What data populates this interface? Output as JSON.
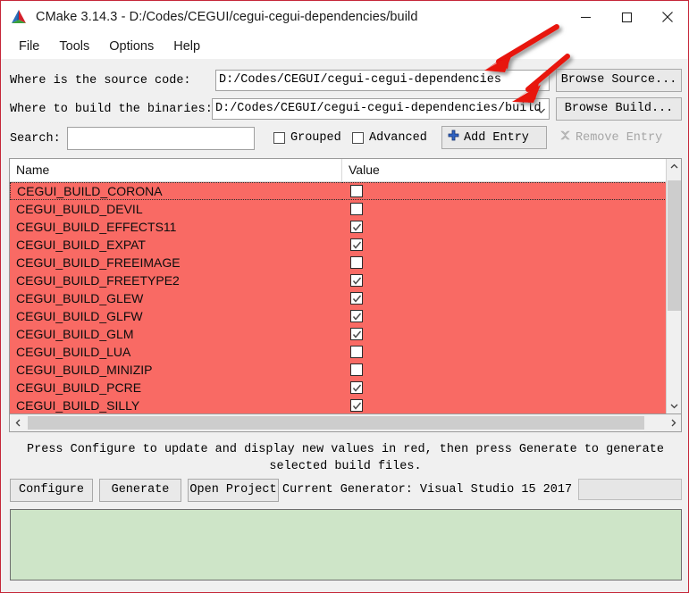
{
  "window": {
    "title": "CMake 3.14.3 - D:/Codes/CEGUI/cegui-cegui-dependencies/build",
    "logo_icon": "cmake-logo-icon",
    "minimize_icon": "minimize-icon",
    "maximize_icon": "maximize-icon",
    "close_icon": "close-icon"
  },
  "menubar": {
    "items": [
      {
        "label": "File"
      },
      {
        "label": "Tools"
      },
      {
        "label": "Options"
      },
      {
        "label": "Help"
      }
    ]
  },
  "paths": {
    "source_label": "Where is the source code:",
    "source_value": "D:/Codes/CEGUI/cegui-cegui-dependencies",
    "browse_source_label": "Browse Source...",
    "binaries_label": "Where to build the binaries:",
    "binaries_value": "D:/Codes/CEGUI/cegui-cegui-dependencies/build",
    "binaries_dropdown_icon": "chevron-down-icon",
    "browse_build_label": "Browse Build..."
  },
  "search": {
    "label": "Search:",
    "value": "",
    "placeholder": "",
    "grouped_label": "Grouped",
    "grouped_checked": false,
    "advanced_label": "Advanced",
    "advanced_checked": false,
    "add_entry_label": "Add Entry",
    "add_entry_icon": "plus-icon",
    "remove_entry_label": "Remove Entry",
    "remove_entry_icon": "remove-x-icon",
    "remove_entry_enabled": false
  },
  "table": {
    "columns": [
      "Name",
      "Value"
    ],
    "row_highlight_color": "#f96a64",
    "rows": [
      {
        "name": "CEGUI_BUILD_CORONA",
        "checked": false,
        "focused": true
      },
      {
        "name": "CEGUI_BUILD_DEVIL",
        "checked": false,
        "focused": false
      },
      {
        "name": "CEGUI_BUILD_EFFECTS11",
        "checked": true,
        "focused": false
      },
      {
        "name": "CEGUI_BUILD_EXPAT",
        "checked": true,
        "focused": false
      },
      {
        "name": "CEGUI_BUILD_FREEIMAGE",
        "checked": false,
        "focused": false
      },
      {
        "name": "CEGUI_BUILD_FREETYPE2",
        "checked": true,
        "focused": false
      },
      {
        "name": "CEGUI_BUILD_GLEW",
        "checked": true,
        "focused": false
      },
      {
        "name": "CEGUI_BUILD_GLFW",
        "checked": true,
        "focused": false
      },
      {
        "name": "CEGUI_BUILD_GLM",
        "checked": true,
        "focused": false
      },
      {
        "name": "CEGUI_BUILD_LUA",
        "checked": false,
        "focused": false
      },
      {
        "name": "CEGUI_BUILD_MINIZIP",
        "checked": false,
        "focused": false
      },
      {
        "name": "CEGUI_BUILD_PCRE",
        "checked": true,
        "focused": false
      },
      {
        "name": "CEGUI_BUILD_SILLY",
        "checked": true,
        "focused": false
      },
      {
        "name": "",
        "checked": true,
        "focused": false
      }
    ],
    "scroll_up_icon": "chevron-up-icon",
    "scroll_down_icon": "chevron-down-icon",
    "scroll_left_icon": "chevron-left-icon",
    "scroll_right_icon": "chevron-right-icon"
  },
  "status": {
    "text": "Press Configure to update and display new values in red, then press Generate to generate selected build files."
  },
  "actions": {
    "configure_label": "Configure",
    "generate_label": "Generate",
    "open_project_label": "Open Project",
    "current_generator_label": "Current Generator: Visual Studio 15 2017"
  },
  "output": {
    "text": "",
    "background_color": "#cee5c8"
  },
  "annotations": {
    "arrow_color": "#e8120e",
    "arrows": [
      {
        "name": "arrow-to-source-field"
      },
      {
        "name": "arrow-to-build-field"
      }
    ]
  }
}
